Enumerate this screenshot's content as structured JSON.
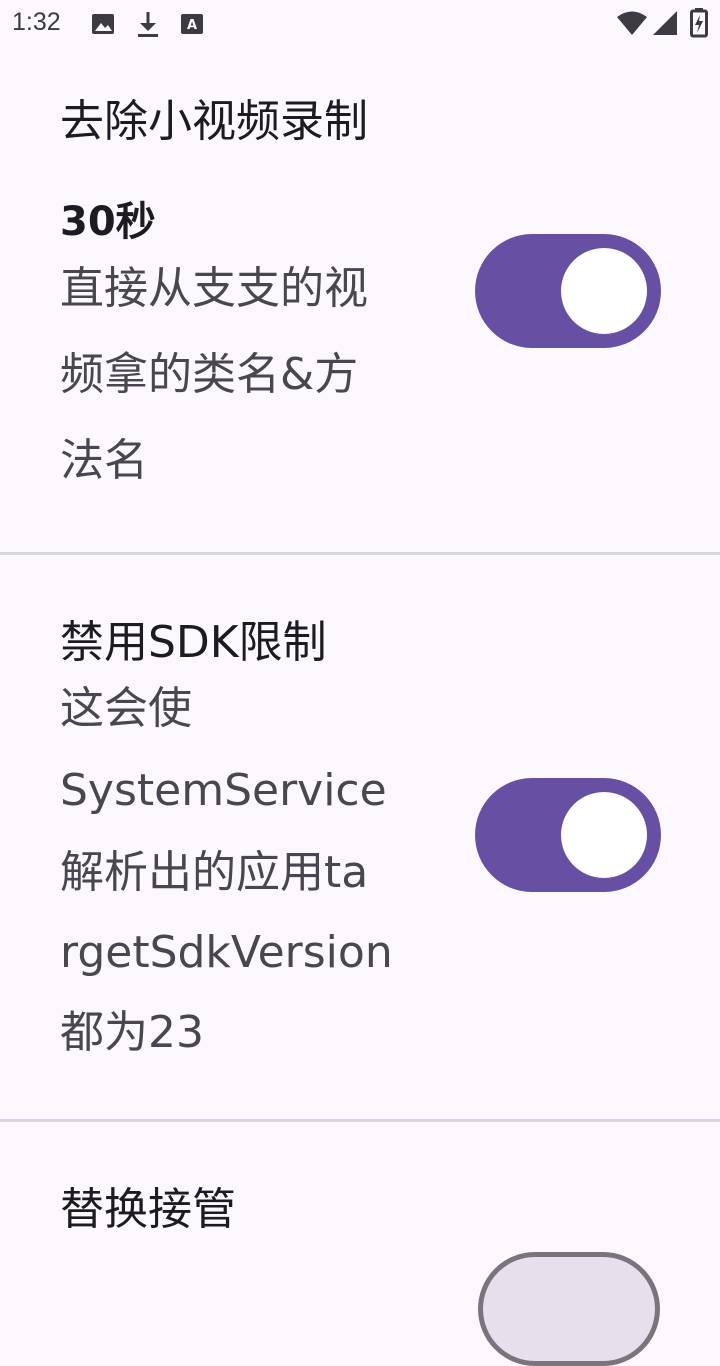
{
  "status_bar": {
    "time": "1:32",
    "icons": [
      "image-icon",
      "download-icon",
      "text-a-icon",
      "wifi-icon",
      "signal-icon",
      "battery-icon"
    ]
  },
  "settings": [
    {
      "title": "去除小视频录制",
      "summary_strong": "30秒",
      "summary_lines": [
        "直接从支支的视",
        "频拿的类名&方",
        "法名"
      ],
      "switch_on": true
    },
    {
      "title": "禁用SDK限制",
      "summary_lines": [
        "这会使",
        "SystemService",
        "解析出的应用ta",
        "rgetSdkVersion",
        "都为23"
      ],
      "switch_on": true
    },
    {
      "title": "替换接管",
      "switch_on": false
    }
  ],
  "colors": {
    "accent": "#6750a4",
    "background": "#fdf8fd",
    "divider": "#d9d6dc"
  }
}
